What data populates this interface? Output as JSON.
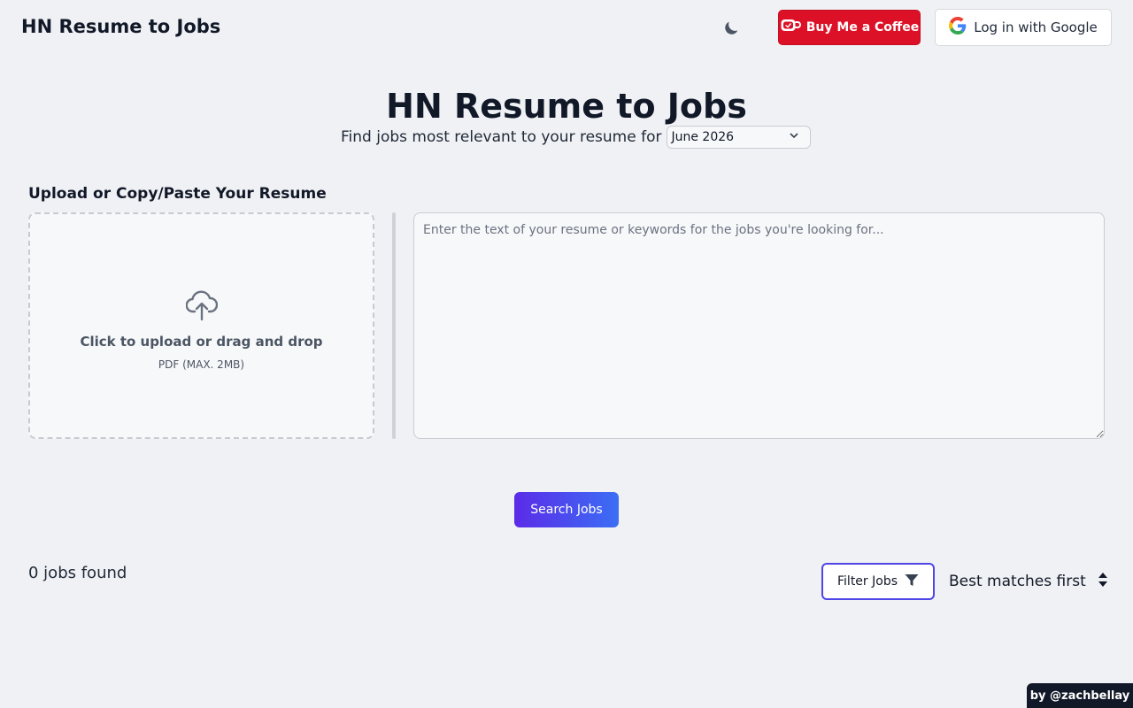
{
  "header": {
    "brand": "HN Resume to Jobs",
    "coffee_label": "Buy Me a Coffee",
    "google_label": "Log in with Google"
  },
  "hero": {
    "title": "HN Resume to Jobs",
    "subtitle": "Find jobs most relevant to your resume for",
    "selected_month": "June 2026"
  },
  "upload": {
    "section_label": "Upload or Copy/Paste Your Resume",
    "dropzone_main": "Click to upload or drag and drop",
    "dropzone_sub": "PDF (MAX. 2MB)",
    "textarea_placeholder": "Enter the text of your resume or keywords for the jobs you're looking for...",
    "textarea_value": ""
  },
  "actions": {
    "search_label": "Search Jobs"
  },
  "results": {
    "count_text": "0 jobs found",
    "filter_label": "Filter Jobs",
    "sort_selected": "Best matches first"
  },
  "footer": {
    "credit": "by @zachbellay"
  },
  "colors": {
    "coffee_red": "#dc1127",
    "accent_indigo": "#4f46e5",
    "search_gradient_start": "#5b2be8",
    "search_gradient_end": "#3b6ef5",
    "background": "#f0f1f4"
  },
  "icons": {
    "theme_toggle": "moon-icon",
    "coffee": "coffee-cup-icon",
    "google": "google-g-icon",
    "upload": "cloud-upload-icon",
    "month_dropdown": "chevron-down-icon",
    "filter": "funnel-icon",
    "sort": "sort-arrows-icon"
  }
}
